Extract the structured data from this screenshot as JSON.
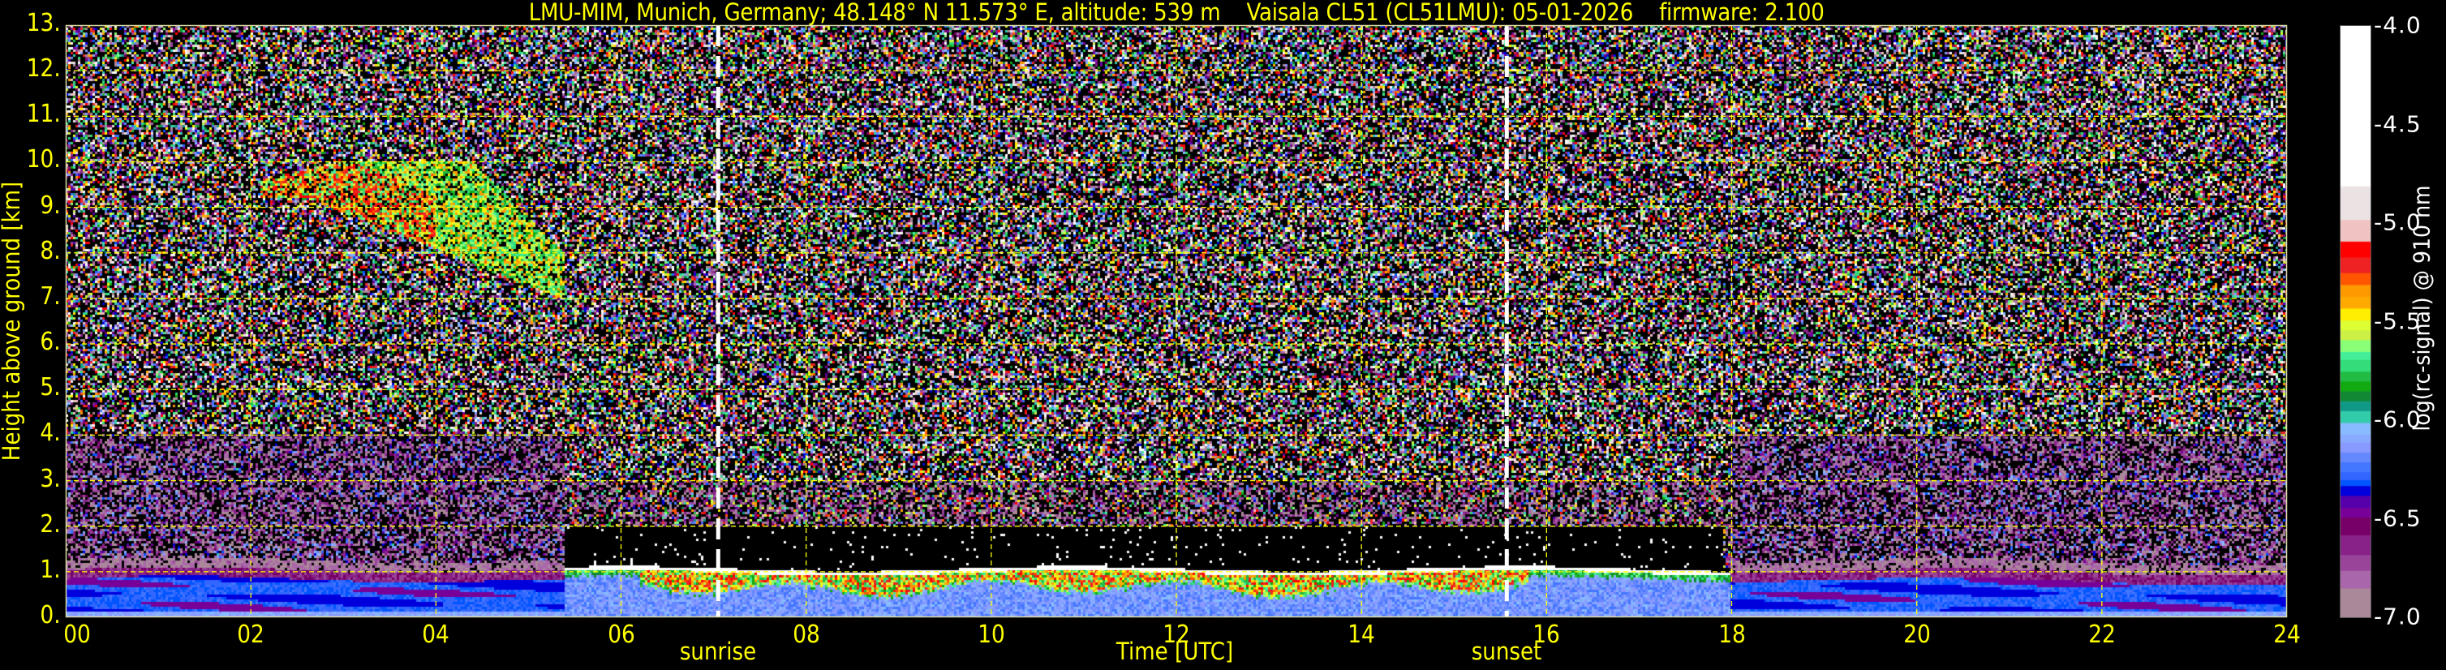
{
  "title": "LMU-MIM, Munich, Germany; 48.148° N 11.573° E, altitude: 539 m    Vaisala CL51 (CL51LMU): 05-01-2026    firmware: 2.100",
  "chart_data": {
    "type": "heatmap",
    "xlabel": "Time [UTC]",
    "ylabel": "Height above ground [km]",
    "xlim": [
      0,
      24
    ],
    "ylim": [
      0,
      13
    ],
    "x_ticks": [
      "00",
      "02",
      "04",
      "06",
      "08",
      "10",
      "12",
      "14",
      "16",
      "18",
      "20",
      "22",
      "24"
    ],
    "x_tick_values": [
      0,
      2,
      4,
      6,
      8,
      10,
      12,
      14,
      16,
      18,
      20,
      22,
      24
    ],
    "y_ticks": [
      "0.",
      "1.",
      "2.",
      "3.",
      "4.",
      "5.",
      "6.",
      "7.",
      "8.",
      "9.",
      "10.",
      "11.",
      "12.",
      "13."
    ],
    "y_tick_values": [
      0,
      1,
      2,
      3,
      4,
      5,
      6,
      7,
      8,
      9,
      10,
      11,
      12,
      13
    ],
    "grid": true,
    "grid_color": "#ffff00",
    "annotations": [
      {
        "label": "sunrise",
        "time": 7.05,
        "color": "#ffffff"
      },
      {
        "label": "sunset",
        "time": 15.57,
        "color": "#ffffff"
      }
    ],
    "colorbar": {
      "label": "log(rc-signal) @ 910 nm",
      "range": [
        -7.0,
        -4.0
      ],
      "ticks": [
        "-4.0",
        "-4.5",
        "-5.0",
        "-5.5",
        "-6.0",
        "-6.5",
        "-7.0"
      ],
      "tick_values": [
        -4.0,
        -4.5,
        -5.0,
        -5.5,
        -6.0,
        -6.5,
        -7.0
      ],
      "levels": [
        -7.0,
        -6.85,
        -6.76,
        -6.68,
        -6.58,
        -6.49,
        -6.44,
        -6.38,
        -6.33,
        -6.3,
        -6.26,
        -6.21,
        -6.16,
        -6.11,
        -6.07,
        -6.01,
        -5.95,
        -5.9,
        -5.85,
        -5.8,
        -5.75,
        -5.69,
        -5.65,
        -5.59,
        -5.54,
        -5.49,
        -5.43,
        -5.37,
        -5.31,
        -5.25,
        -5.17,
        -5.09,
        -4.98,
        -4.81,
        -4.0
      ],
      "colors": [
        "#aa8899",
        "#aa66aa",
        "#994499",
        "#882288",
        "#770066",
        "#770099",
        "#5500aa",
        "#0000dd",
        "#0055ff",
        "#3366ff",
        "#4477ff",
        "#6688ff",
        "#8899ff",
        "#88aaff",
        "#88bbff",
        "#33ccaa",
        "#119988",
        "#118833",
        "#11aa11",
        "#22bb44",
        "#33dd77",
        "#44ee99",
        "#88ff77",
        "#ccf044",
        "#ddff33",
        "#ffee00",
        "#ffaa00",
        "#ff9900",
        "#ff5500",
        "#ee2222",
        "#ff0000",
        "#f0c3c3",
        "#ebe3e3",
        "#ffffff"
      ]
    },
    "features": {
      "boundary_layer_top_km": 1.0,
      "cloud_top_layer_time": [
        5.4,
        18.0
      ],
      "cirrus_layer": {
        "time": [
          2.1,
          5.4
        ],
        "height_km": [
          7.0,
          10.0
        ]
      }
    }
  }
}
